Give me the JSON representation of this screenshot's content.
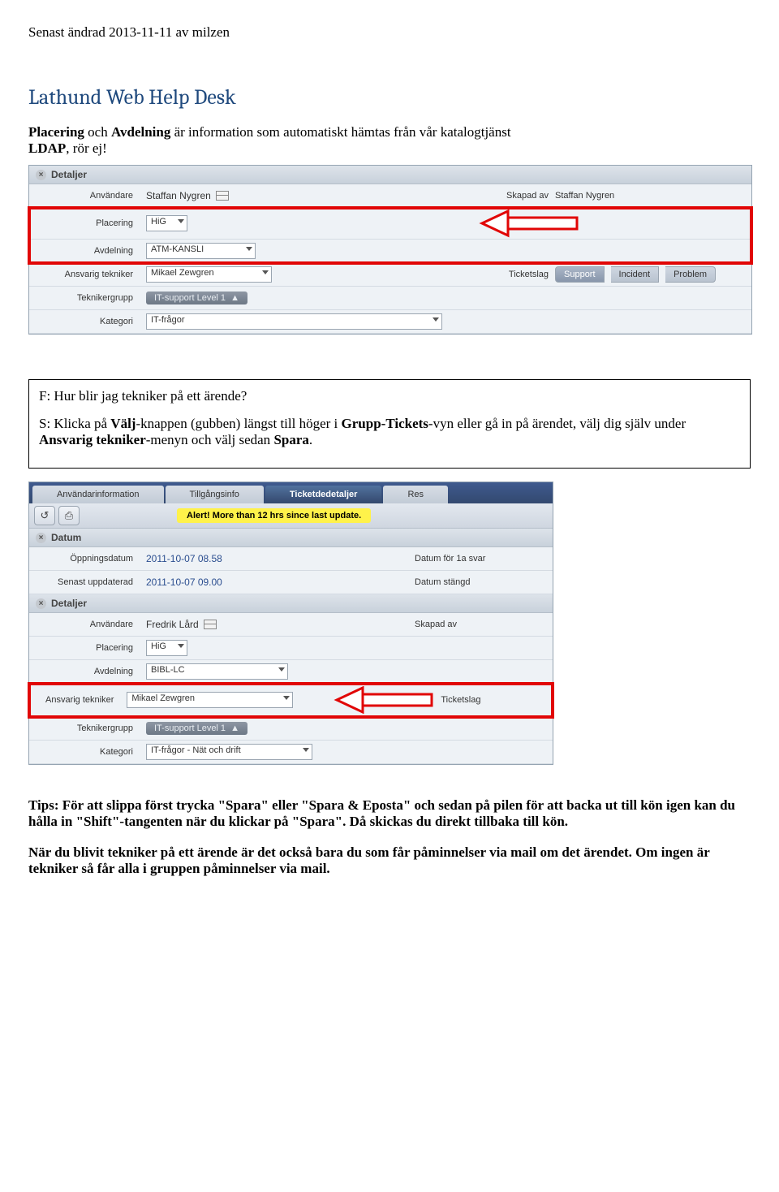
{
  "header": "Senast ändrad 2013-11-11 av milzen",
  "title": "Lathund Web Help Desk",
  "intro_parts": {
    "p1": "Placering",
    "p2": " och ",
    "p3": "Avdelning",
    "p4": " är information som automatiskt hämtas från vår katalogtjänst ",
    "p5": "LDAP",
    "p6": ", rör ej!"
  },
  "shot1": {
    "section_head": "Detaljer",
    "rows": {
      "anvandare": {
        "label": "Användare",
        "value": "Staffan Nygren"
      },
      "skapad": {
        "label": "Skapad av",
        "value": "Staffan Nygren"
      },
      "placering": {
        "label": "Placering",
        "value": "HiG"
      },
      "avdelning": {
        "label": "Avdelning",
        "value": "ATM-KANSLI"
      },
      "tekniker": {
        "label": "Ansvarig tekniker",
        "value": "Mikael Zewgren"
      },
      "ticketslag": {
        "label": "Ticketslag",
        "t1": "Support",
        "t2": "Incident",
        "t3": "Problem"
      },
      "grupp": {
        "label": "Teknikergrupp",
        "value": "IT-support Level 1"
      },
      "kategori": {
        "label": "Kategori",
        "value": "IT-frågor"
      }
    }
  },
  "faq": {
    "q": "F: Hur blir jag tekniker på ett ärende?",
    "a1": "S: Klicka på ",
    "a2": "Välj",
    "a3": "-knappen (gubben) längst till höger i ",
    "a4": "Grupp-Tickets",
    "a5": "-vyn eller gå in på ärendet, välj dig själv under ",
    "a6": "Ansvarig tekniker",
    "a7": "-menyn och välj sedan ",
    "a8": "Spara",
    "a9": "."
  },
  "shot2": {
    "tabs": {
      "t1": "Användarinformation",
      "t2": "Tillgångsinfo",
      "t3": "Ticketdedetaljer",
      "t4": "Res"
    },
    "alert": "Alert! More than 12 hrs since last update.",
    "sec1": "Datum",
    "oppn": {
      "label": "Öppningsdatum",
      "value": "2011-10-07 08.58",
      "r": "Datum för 1a svar"
    },
    "senast": {
      "label": "Senast uppdaterad",
      "value": "2011-10-07 09.00",
      "r": "Datum stängd"
    },
    "sec2": "Detaljer",
    "anvandare": {
      "label": "Användare",
      "value": "Fredrik Lård",
      "r": "Skapad av"
    },
    "placering": {
      "label": "Placering",
      "value": "HiG"
    },
    "avdelning": {
      "label": "Avdelning",
      "value": "BIBL-LC"
    },
    "tekniker": {
      "label": "Ansvarig tekniker",
      "value": "Mikael Zewgren",
      "r": "Ticketslag"
    },
    "grupp": {
      "label": "Teknikergrupp",
      "value": "IT-support Level 1"
    },
    "kategori": {
      "label": "Kategori",
      "value": "IT-frågor - Nät och drift"
    }
  },
  "tips": {
    "p1a": "Tips: För att slippa först trycka \"Spara\" eller \"Spara & Eposta\" och sedan på pilen för att backa ut till kön igen kan du hålla in \"Shift\"-tangenten när du klickar på \"Spara\". Då skickas du direkt tillbaka till kön.",
    "p2": "När du blivit tekniker på ett ärende är det också bara du som får påminnelser via mail om det ärendet. Om ingen är tekniker så får alla i gruppen påminnelser via mail."
  }
}
